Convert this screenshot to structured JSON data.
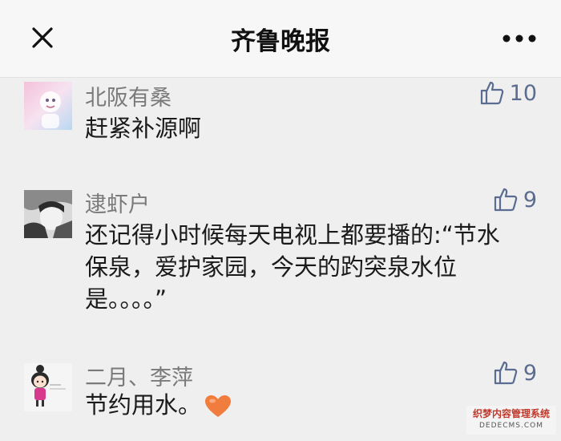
{
  "navbar": {
    "title": "齐鲁晚报",
    "close_icon": "close-icon",
    "more_icon": "more-dots-icon"
  },
  "comments": [
    {
      "author": "北阪有桑",
      "likes": "10",
      "text": "赶紧补源啊"
    },
    {
      "author": "逮虾户",
      "likes": "9",
      "text_lines": [
        "还记得小时候每天电视上都要播的:“节水",
        "保泉，爱护家园，今天的趵突泉水位",
        "是。。。。”"
      ]
    },
    {
      "author": "二月、李萍",
      "likes": "9",
      "text": "节约用水。",
      "emoji": "heart-icon"
    }
  ],
  "watermark": {
    "line1": "织梦内容管理系统",
    "line2": "DEDECMS.COM"
  },
  "colors": {
    "background": "#efefef",
    "navbar_bg": "#f7f7f7",
    "like_blue": "#5b6c91",
    "heart": "#f07c3e"
  }
}
